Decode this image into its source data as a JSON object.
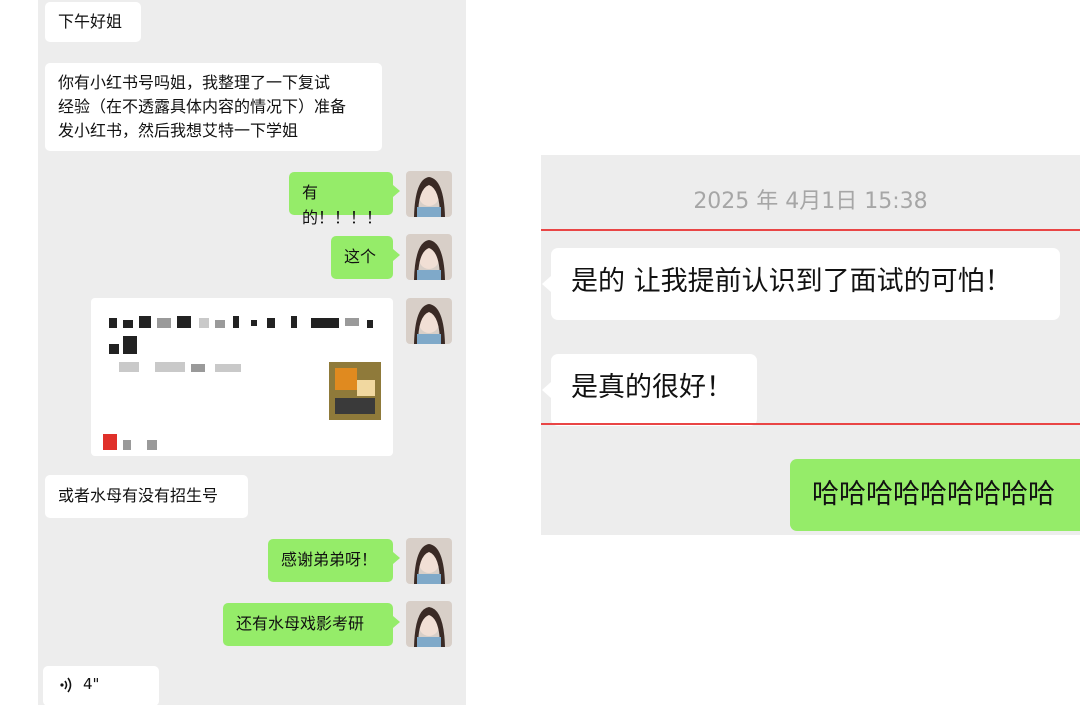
{
  "left_chat": {
    "messages": [
      {
        "side": "incoming",
        "text": "下午好姐"
      },
      {
        "side": "incoming",
        "lines": [
          "你有小红书号吗姐，我整理了一下复试",
          "经验（在不透露具体内容的情况下）准备",
          "发小红书，然后我想艾特一下学姐"
        ]
      },
      {
        "side": "outgoing",
        "text": "有的！！！！"
      },
      {
        "side": "outgoing",
        "text": "这个"
      },
      {
        "side": "outgoing",
        "type": "shared-card-blurred"
      },
      {
        "side": "incoming",
        "text": "或者水母有没有招生号"
      },
      {
        "side": "outgoing",
        "text": "感谢弟弟呀！"
      },
      {
        "side": "outgoing",
        "text": "还有水母戏影考研"
      },
      {
        "side": "incoming",
        "type": "voice",
        "icon": "voice-wave-icon",
        "duration": "4\""
      }
    ]
  },
  "right_chat": {
    "timestamp": "2025 年 4月1日 15:38",
    "messages": [
      {
        "side": "incoming",
        "text": "是的 让我提前认识到了面试的可怕！"
      },
      {
        "side": "incoming",
        "text": "是真的很好！"
      },
      {
        "side": "outgoing",
        "text": "哈哈哈哈哈哈哈哈哈"
      }
    ]
  },
  "colors": {
    "chat_background": "#ededed",
    "incoming_bubble": "#ffffff",
    "outgoing_bubble": "#95ec69",
    "highlight_line": "#e94545",
    "timestamp_text": "#a6a6a6"
  }
}
